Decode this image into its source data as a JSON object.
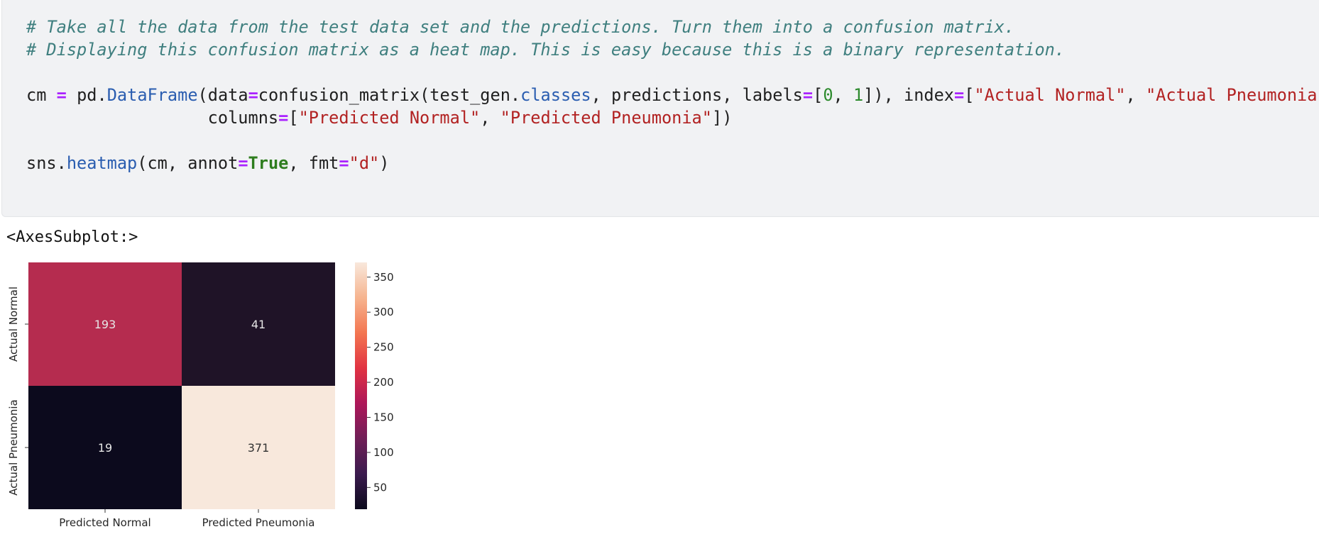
{
  "code_cell": {
    "comment_line_1": "# Take all the data from the test data set and the predictions. Turn them into a confusion matrix.",
    "comment_line_2": "# Displaying this confusion matrix as a heat map. This is easy because this is a binary representation.",
    "line3": {
      "var": "cm",
      "op_assign": "=",
      "obj": "pd.",
      "fn": "DataFrame",
      "open": "(data",
      "op_eq1": "=",
      "call": "confusion_matrix(test_gen.",
      "attr": "classes",
      "rest1": ", predictions, labels",
      "op_eq2": "=",
      "lb": "[",
      "n0": "0",
      "comma": ", ",
      "n1": "1",
      "rb": "]), index",
      "op_eq3": "=",
      "lb2": "[",
      "s1": "\"Actual Normal\"",
      "sep": ", ",
      "s2": "\"Actual Pneumonia\"",
      "end": "],"
    },
    "line4": {
      "indent": "                  columns",
      "op_eq": "=",
      "lb": "[",
      "s1": "\"Predicted Normal\"",
      "sep": ", ",
      "s2": "\"Predicted Pneumonia\"",
      "end": "])"
    },
    "line6": {
      "obj": "sns.",
      "fn": "heatmap",
      "args": "(cm, annot",
      "op_eq1": "=",
      "kw": "True",
      "sep": ", fmt",
      "op_eq2": "=",
      "s": "\"d\"",
      "end": ")"
    }
  },
  "output": {
    "text": "<AxesSubplot:>"
  },
  "chart_data": {
    "type": "heatmap",
    "rows": [
      "Actual Normal",
      "Actual Pneumonia"
    ],
    "columns": [
      "Predicted Normal",
      "Predicted Pneumonia"
    ],
    "values": [
      [
        193,
        41
      ],
      [
        19,
        371
      ]
    ],
    "colormap": "rocket",
    "colorbar": {
      "range": [
        19,
        371
      ],
      "ticks": [
        50,
        100,
        150,
        200,
        250,
        300,
        350
      ]
    },
    "colors": {
      "value_193": "#b52c4f",
      "value_41": "#1f1327",
      "value_19": "#0c0a1d",
      "value_371": "#f8e8dc",
      "colorbar_stops": [
        "#0c0a1d",
        "#3b1b4e",
        "#701f57",
        "#ad1759",
        "#e13342",
        "#f37651",
        "#f6b48f",
        "#f8e8dc"
      ]
    }
  }
}
